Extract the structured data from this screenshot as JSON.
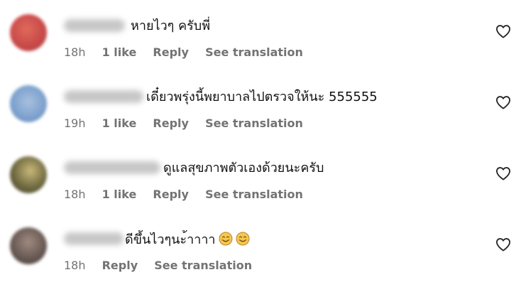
{
  "comments": [
    {
      "text": "หายไวๆ ครับพี่",
      "time": "18h",
      "likes": "1 like",
      "reply": "Reply",
      "translate": "See translation",
      "avatar_color": "#d94e4e",
      "emojis": []
    },
    {
      "text": "เดี๋ยวพรุ่งนี้พยาบาลไปตรวจให้นะ 555555",
      "time": "19h",
      "likes": "1 like",
      "reply": "Reply",
      "translate": "See translation",
      "avatar_color": "#7fa3cf",
      "emojis": []
    },
    {
      "text": "ดูแลสุขภาพตัวเองด้วยนะครับ",
      "time": "18h",
      "likes": "1 like",
      "reply": "Reply",
      "translate": "See translation",
      "avatar_color": "#6f6a40",
      "emojis": []
    },
    {
      "text": "ดีขึ้นไวๆนะ้าาาา",
      "time": "18h",
      "likes": "",
      "reply": "Reply",
      "translate": "See translation",
      "avatar_color": "#6a5b55",
      "emojis": [
        "smiling-face-emoji",
        "smiling-face-emoji"
      ]
    }
  ],
  "colors": {
    "text": "#111111",
    "meta": "#737373",
    "emoji_face": "#f5c84c"
  }
}
